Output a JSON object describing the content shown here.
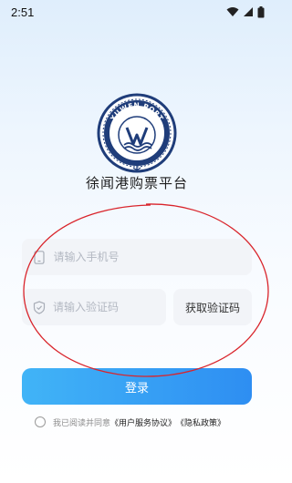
{
  "status_bar": {
    "time": "2:51",
    "icons": [
      "wifi-icon",
      "cellular-signal-icon",
      "battery-icon"
    ]
  },
  "app": {
    "title": "徐闻港购票平台",
    "logo_text": "XUWEN PORT",
    "logo_icon": "port-logo-icon"
  },
  "form": {
    "phone": {
      "placeholder": "请输入手机号",
      "value": "",
      "icon": "phone-icon"
    },
    "code": {
      "placeholder": "请输入验证码",
      "value": "",
      "icon": "shield-icon"
    },
    "get_code_label": "获取验证码",
    "login_label": "登录"
  },
  "agreement": {
    "prefix": "我已阅读并同意",
    "user_agreement": "《用户服务协议》",
    "privacy_policy": "《隐私政策》",
    "checked": false
  },
  "colors": {
    "primary_start": "#41b4f7",
    "primary_end": "#2e8ef2",
    "logo_navy": "#1f3d7a",
    "annotation_red": "#d9242b"
  }
}
